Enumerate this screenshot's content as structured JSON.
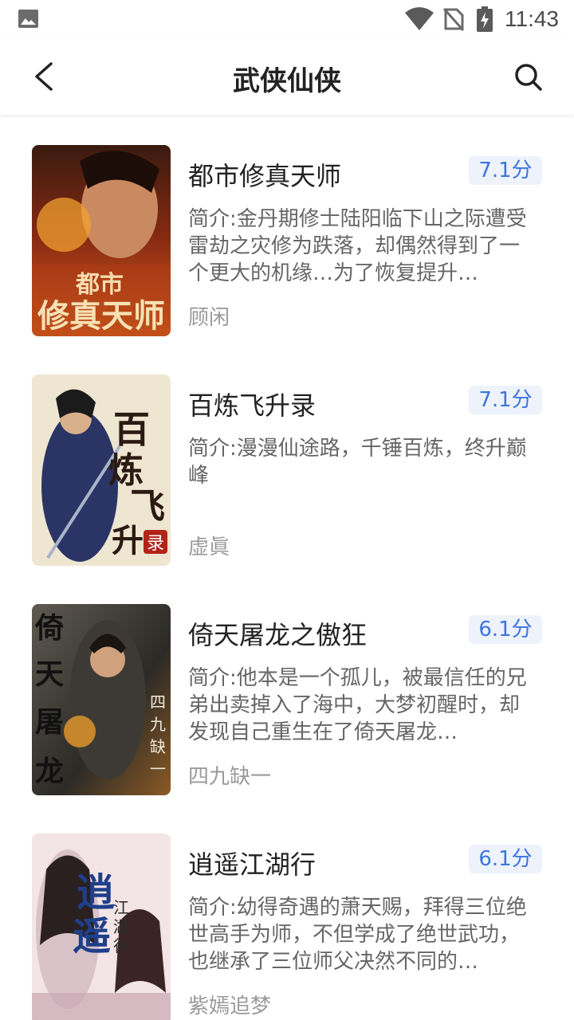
{
  "status_bar": {
    "time": "11:43",
    "icons": [
      "image-icon",
      "wifi-icon",
      "no-sim-icon",
      "battery-charging-icon"
    ]
  },
  "header": {
    "title": "武侠仙侠",
    "back_icon": "back-arrow-icon",
    "search_icon": "search-icon"
  },
  "books": [
    {
      "title": "都市修真天师",
      "score": "7.1分",
      "desc": "简介:金丹期修士陆阳临下山之际遭受雷劫之灾修为跌落，却偶然得到了一个更大的机缘…为了恢复提升…",
      "author": "顾闲",
      "cover_text": "都市修真天师"
    },
    {
      "title": "百炼飞升录",
      "score": "7.1分",
      "desc": "简介:漫漫仙途路，千锤百炼，终升巅峰",
      "author": "虚眞",
      "cover_text": "百炼飞升录"
    },
    {
      "title": "倚天屠龙之傲狂",
      "score": "6.1分",
      "desc": "简介:他本是一个孤儿，被最信任的兄弟出卖掉入了海中，大梦初醒时，却发现自己重生在了倚天屠龙…",
      "author": "四九缺一",
      "cover_text": "倚天屠龙"
    },
    {
      "title": "逍遥江湖行",
      "score": "6.1分",
      "desc": "简介:幼得奇遇的萧天赐，拜得三位绝世高手为师，不但学成了绝世武功，也继承了三位师父决然不同的…",
      "author": "紫嫣追梦",
      "cover_text": "逍遥江湖行"
    }
  ],
  "colors": {
    "score_text": "#3c75e0",
    "score_bg": "#eef2fb",
    "title_text": "#222222",
    "desc_text": "#666666",
    "author_text": "#9a9a9a"
  }
}
